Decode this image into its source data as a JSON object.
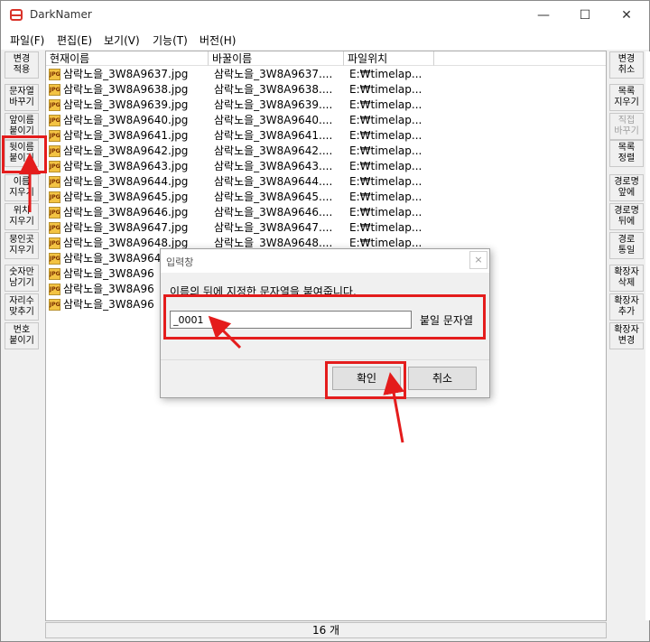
{
  "window": {
    "title": "DarkNamer",
    "minimize": "—",
    "maximize": "☐",
    "close": "✕"
  },
  "menu": [
    "파일(F)",
    "편집(E)",
    "보기(V)",
    "기능(T)",
    "버전(H)"
  ],
  "left_buttons": [
    "변경\n적용",
    "문자열\n바꾸기",
    "앞이름\n붙이기",
    "뒷이름\n붙이기",
    "이름\n지우기",
    "위치\n지우기",
    "뭉인곳\n지우기",
    "숫자만\n남기기",
    "자리수\n맞추기",
    "번호\n붙이기"
  ],
  "right_buttons": [
    "변경\n취소",
    "목록\n지우기",
    "직접\n바꾸기",
    "목록\n정렬",
    "경로명\n앞에",
    "경로명\n뒤에",
    "경로\n통일",
    "확장자\n삭제",
    "확장자\n추가",
    "확장자\n변경"
  ],
  "columns": [
    "현재이름",
    "바꿀이름",
    "파일위치"
  ],
  "files": [
    {
      "current": "삼락노을_3W8A9637.jpg",
      "new": "삼락노을_3W8A9637....",
      "loc": "E:₩timelap..."
    },
    {
      "current": "삼락노을_3W8A9638.jpg",
      "new": "삼락노을_3W8A9638....",
      "loc": "E:₩timelap..."
    },
    {
      "current": "삼락노을_3W8A9639.jpg",
      "new": "삼락노을_3W8A9639....",
      "loc": "E:₩timelap..."
    },
    {
      "current": "삼락노을_3W8A9640.jpg",
      "new": "삼락노을_3W8A9640....",
      "loc": "E:₩timelap..."
    },
    {
      "current": "삼락노을_3W8A9641.jpg",
      "new": "삼락노을_3W8A9641....",
      "loc": "E:₩timelap..."
    },
    {
      "current": "삼락노을_3W8A9642.jpg",
      "new": "삼락노을_3W8A9642....",
      "loc": "E:₩timelap..."
    },
    {
      "current": "삼락노을_3W8A9643.jpg",
      "new": "삼락노을_3W8A9643....",
      "loc": "E:₩timelap..."
    },
    {
      "current": "삼락노을_3W8A9644.jpg",
      "new": "삼락노을_3W8A9644....",
      "loc": "E:₩timelap..."
    },
    {
      "current": "삼락노을_3W8A9645.jpg",
      "new": "삼락노을_3W8A9645....",
      "loc": "E:₩timelap..."
    },
    {
      "current": "삼락노을_3W8A9646.jpg",
      "new": "삼락노을_3W8A9646....",
      "loc": "E:₩timelap..."
    },
    {
      "current": "삼락노을_3W8A9647.jpg",
      "new": "삼락노을_3W8A9647....",
      "loc": "E:₩timelap..."
    },
    {
      "current": "삼락노을_3W8A9648.jpg",
      "new": "삼락노을_3W8A9648....",
      "loc": "E:₩timelap..."
    },
    {
      "current": "삼락노을_3W8A964",
      "new": "",
      "loc": ""
    },
    {
      "current": "삼락노을_3W8A96",
      "new": "",
      "loc": ""
    },
    {
      "current": "삼락노을_3W8A96",
      "new": "",
      "loc": ""
    },
    {
      "current": "삼락노을_3W8A96",
      "new": "",
      "loc": ""
    }
  ],
  "status": "16 개",
  "dialog": {
    "title": "입력창",
    "close": "×",
    "message": "이름의 뒤에 지정한 문자열을 붙여줍니다.",
    "input_value": "_0001",
    "input_label": "붙일 문자열",
    "ok": "확인",
    "cancel": "취소"
  },
  "annotation_color": "#e41c1c"
}
